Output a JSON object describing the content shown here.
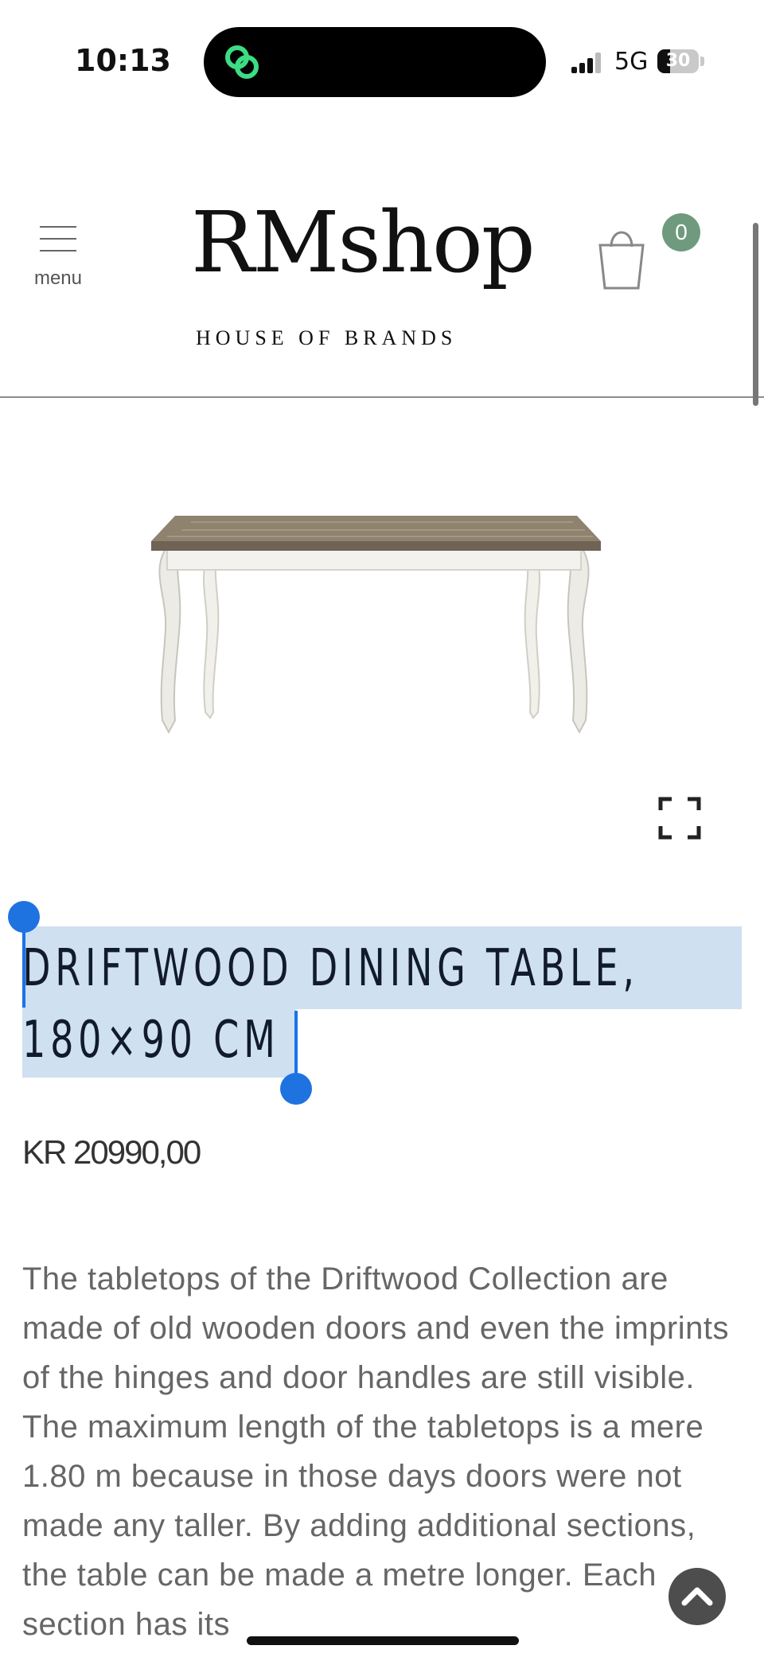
{
  "status": {
    "time": "10:13",
    "network": "5G",
    "battery": "30",
    "battery_level": 0.3,
    "signal_bars": 3
  },
  "header": {
    "menu_label": "menu",
    "logo_main": "RMshop",
    "logo_sub": "HOUSE OF BRANDS",
    "cart_count": "0"
  },
  "product": {
    "title_line1": "DRIFTWOOD DINING TABLE,",
    "title_line2": "180×90 CM",
    "price": "KR 20990,00",
    "description": "The tabletops of the Driftwood Collection are made of old wooden doors and even the imprints of the hinges and door handles are still visible. The maximum length of the tabletops is a mere 1.80 m because in those days doors were not made any taller. By adding additional sections, the table can be made a metre longer. Each section has its"
  },
  "colors": {
    "accent_badge": "#6f9a7d",
    "selection": "#cfe0f1",
    "selection_handle": "#1f73e0",
    "title_text": "#111a2e"
  },
  "icons": {
    "menu": "hamburger-icon",
    "cart": "shopping-bag-icon",
    "expand": "fullscreen-icon",
    "scroll_top": "chevron-up-icon",
    "island_app": "link-rings-icon"
  }
}
